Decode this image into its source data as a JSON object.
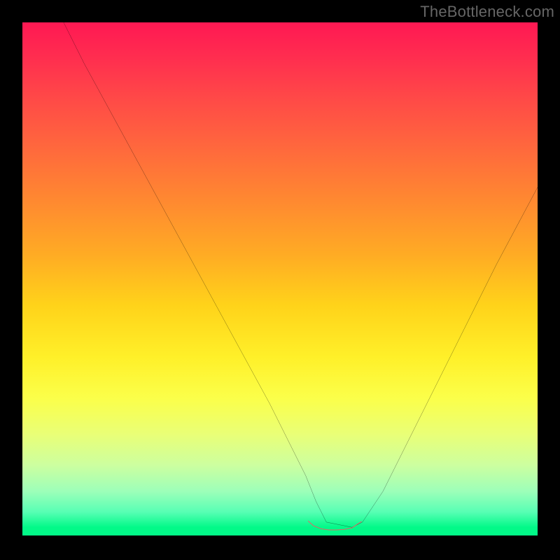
{
  "watermark": "TheBottleneck.com",
  "chart_data": {
    "type": "line",
    "title": "",
    "xlabel": "",
    "ylabel": "",
    "xlim": [
      0,
      100
    ],
    "ylim": [
      0,
      100
    ],
    "grid": false,
    "legend": false,
    "series": [
      {
        "name": "curve-black",
        "color": "#000000",
        "x": [
          8,
          12,
          18,
          24,
          30,
          36,
          42,
          48,
          52,
          55,
          57,
          59,
          64,
          66,
          70,
          74,
          80,
          86,
          92,
          100
        ],
        "y": [
          100,
          92,
          81,
          70,
          59,
          48,
          37,
          26,
          18,
          12,
          7,
          3,
          2,
          3,
          9,
          17,
          29,
          41,
          53,
          68
        ]
      },
      {
        "name": "highlight-coral",
        "color": "#e06666",
        "x": [
          55.5,
          56.5,
          58,
          59.5,
          61,
          62.5,
          64,
          65,
          65.8
        ],
        "y": [
          3.2,
          2.3,
          1.7,
          1.5,
          1.5,
          1.6,
          1.9,
          2.6,
          3.1
        ]
      }
    ],
    "background_gradient": {
      "direction": "vertical",
      "stops": [
        {
          "pos": 0.0,
          "color": "#ff1853"
        },
        {
          "pos": 0.07,
          "color": "#ff2e4f"
        },
        {
          "pos": 0.15,
          "color": "#ff4a47"
        },
        {
          "pos": 0.25,
          "color": "#ff6a3c"
        },
        {
          "pos": 0.35,
          "color": "#ff8a30"
        },
        {
          "pos": 0.45,
          "color": "#ffab24"
        },
        {
          "pos": 0.55,
          "color": "#ffd31a"
        },
        {
          "pos": 0.65,
          "color": "#fff029"
        },
        {
          "pos": 0.73,
          "color": "#fbff4a"
        },
        {
          "pos": 0.8,
          "color": "#e9ff77"
        },
        {
          "pos": 0.86,
          "color": "#ccffa0"
        },
        {
          "pos": 0.91,
          "color": "#9dffb9"
        },
        {
          "pos": 0.95,
          "color": "#58ffb4"
        },
        {
          "pos": 0.98,
          "color": "#02f988"
        },
        {
          "pos": 1.0,
          "color": "#02f988"
        }
      ]
    }
  }
}
